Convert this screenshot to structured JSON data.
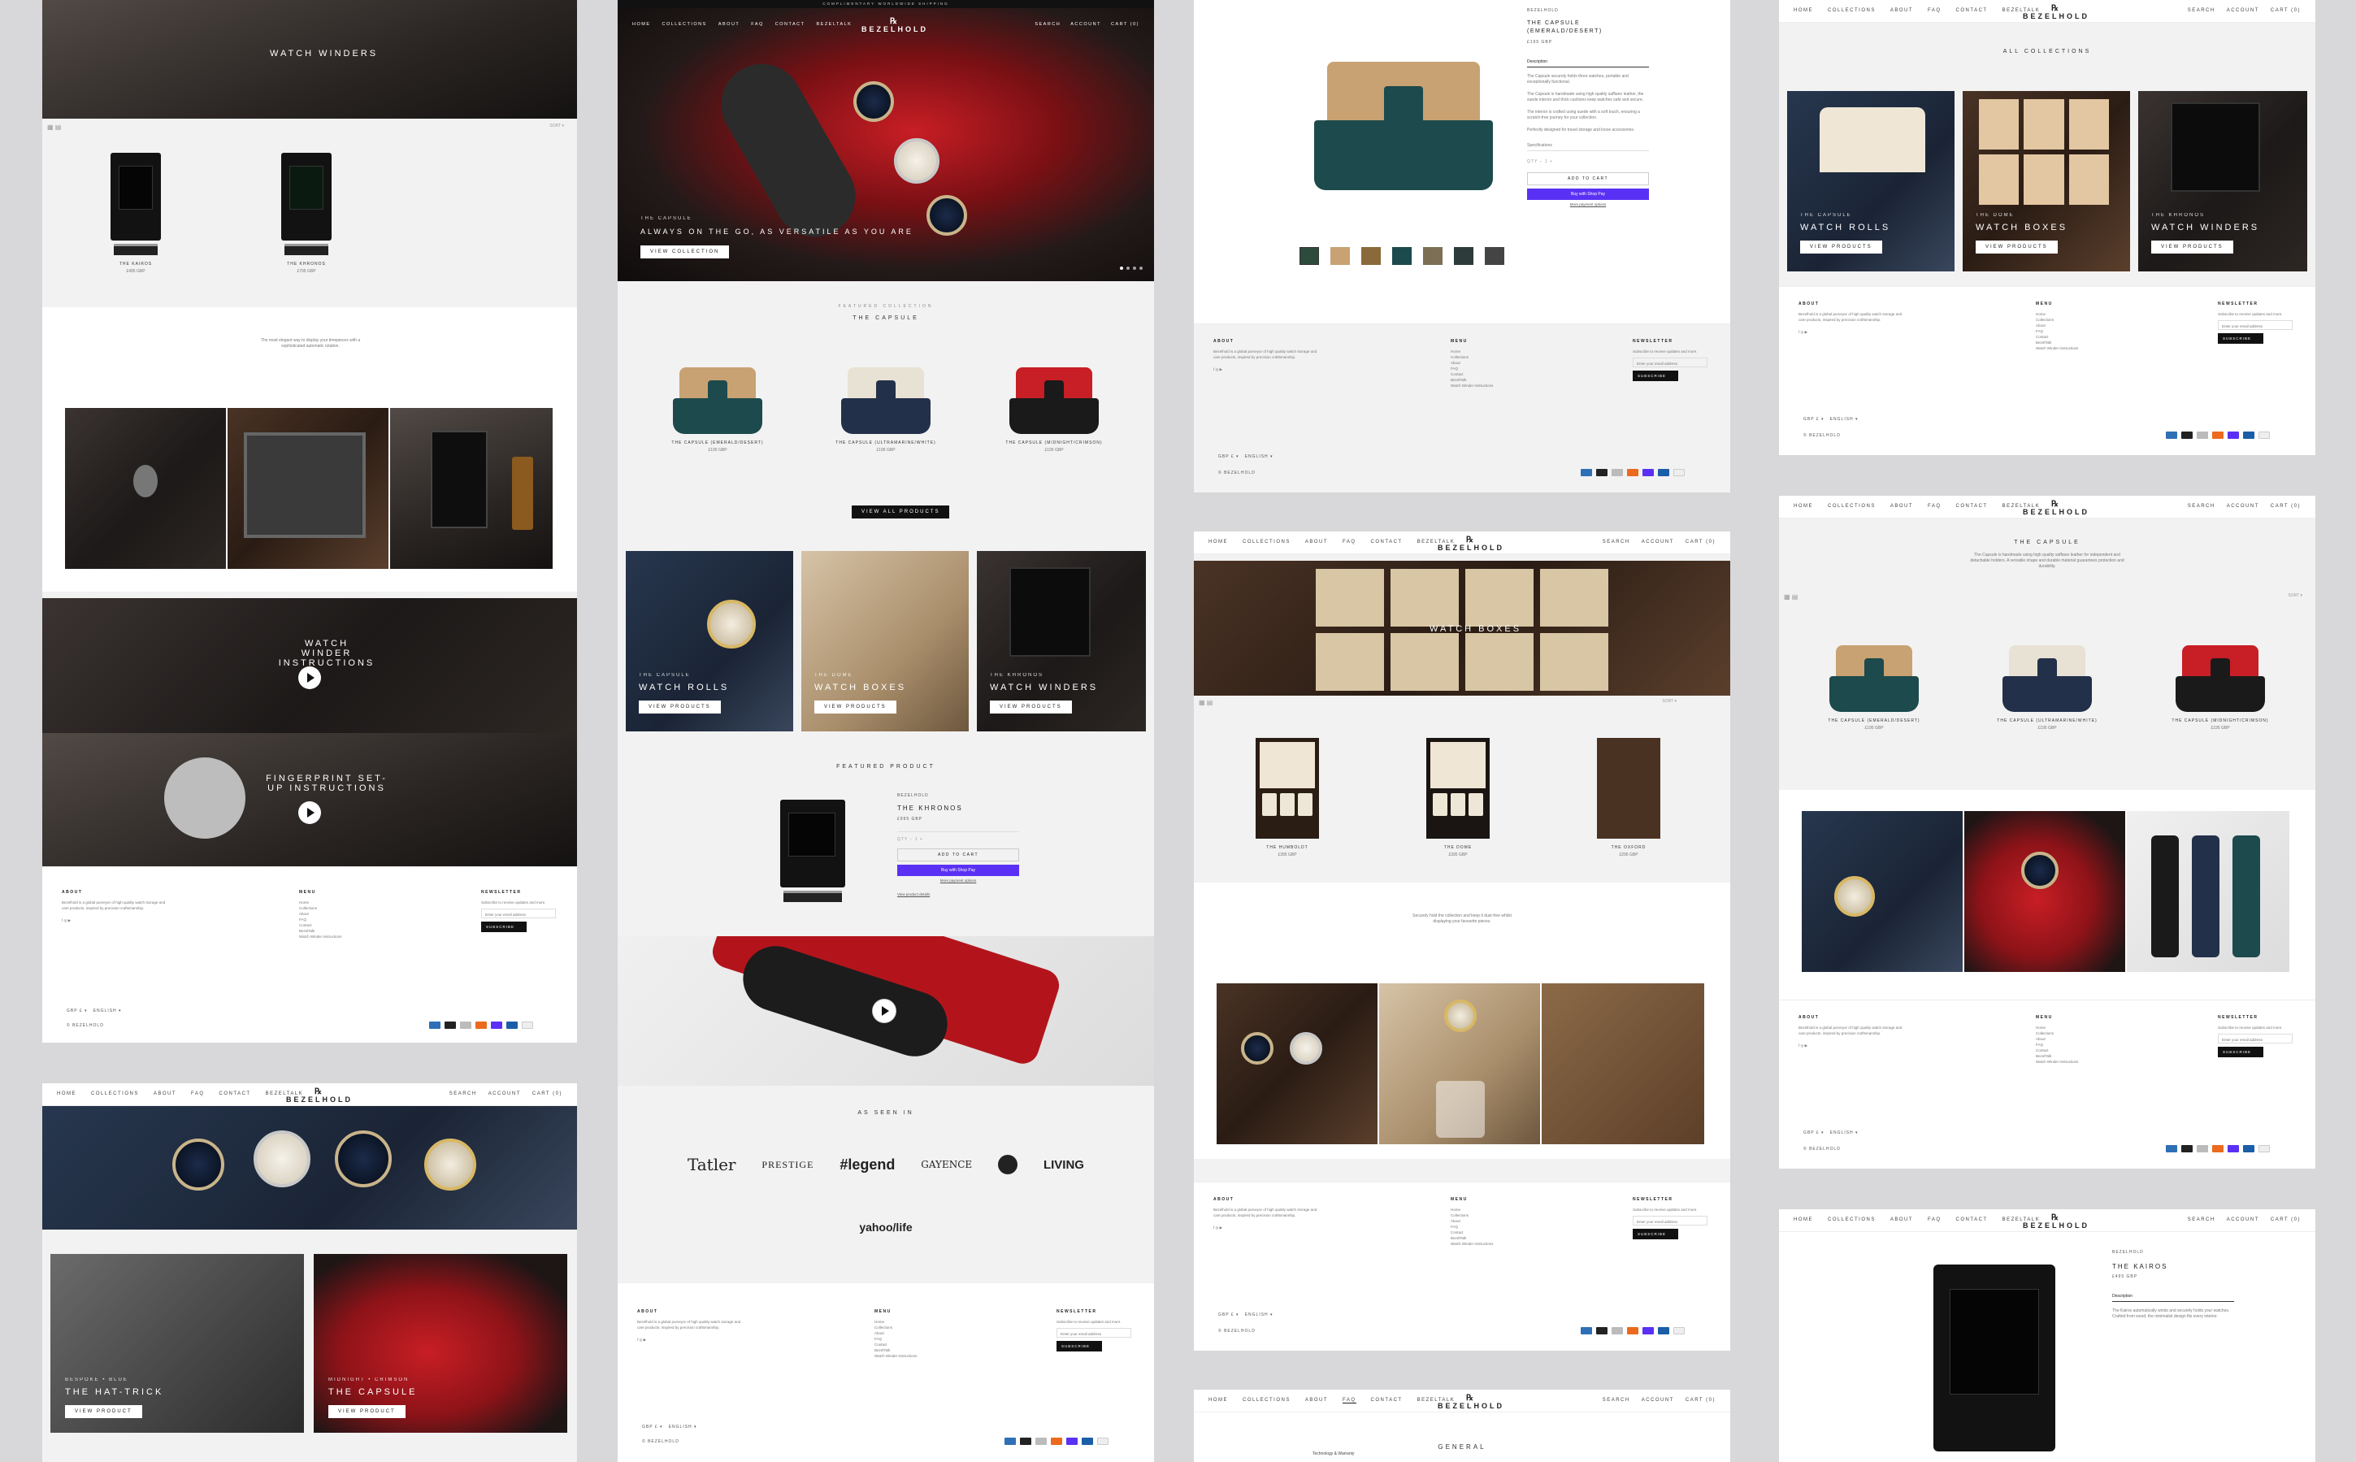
{
  "nav": {
    "links": [
      "HOME",
      "COLLECTIONS",
      "ABOUT",
      "FAQ",
      "CONTACT",
      "BEZELTALK"
    ],
    "right": [
      "SEARCH",
      "ACCOUNT",
      "CART (0)"
    ],
    "brand": "BEZELHOLD",
    "banner": "COMPLIMENTARY WORLDWIDE SHIPPING"
  },
  "col1": {
    "hero_title": "WATCH WINDERS",
    "products": [
      {
        "name": "THE KAIROS",
        "price": "£495 GBP"
      },
      {
        "name": "THE KHRONOS",
        "price": "£795 GBP"
      }
    ],
    "tagline": "The most elegant way to display your timepieces with a sophisticated automatic rotation.",
    "video1": "WATCH WINDER INSTRUCTIONS",
    "video2": "FINGERPRINT SET-UP INSTRUCTIONS",
    "bottom_cards": [
      {
        "sub": "BESPOKE • BLUE",
        "title": "THE HAT-TRICK",
        "btn": "VIEW PRODUCT"
      },
      {
        "sub": "MIDNIGHT • CRIMSON",
        "title": "THE CAPSULE",
        "btn": "VIEW PRODUCT"
      }
    ]
  },
  "col2": {
    "hero_sub": "THE CAPSULE",
    "hero_title": "ALWAYS ON THE GO, AS VERSATILE AS YOU ARE",
    "hero_btn": "VIEW COLLECTION",
    "featured_label": "FEATURED COLLECTION",
    "featured_title": "THE CAPSULE",
    "capsules": [
      {
        "name": "THE CAPSULE (EMERALD/DESERT)",
        "price": "£195 GBP"
      },
      {
        "name": "THE CAPSULE (ULTRAMARINE/WHITE)",
        "price": "£195 GBP"
      },
      {
        "name": "THE CAPSULE (MIDNIGHT/CRIMSON)",
        "price": "£195 GBP"
      }
    ],
    "view_all": "VIEW ALL PRODUCTS",
    "tiles": [
      {
        "sub": "THE CAPSULE",
        "title": "WATCH ROLLS",
        "btn": "VIEW PRODUCTS"
      },
      {
        "sub": "THE DOME",
        "title": "WATCH BOXES",
        "btn": "VIEW PRODUCTS"
      },
      {
        "sub": "THE KHRONOS",
        "title": "WATCH WINDERS",
        "btn": "VIEW PRODUCTS"
      }
    ],
    "featured_product_label": "FEATURED PRODUCT",
    "fp_vendor": "BEZELHOLD",
    "fp_name": "THE KHRONOS",
    "fp_price": "£995 GBP",
    "fp_add": "ADD TO CART",
    "fp_shop": "Buy with Shop Pay",
    "fp_more": "More payment options",
    "fp_full": "View product details",
    "as_seen": "AS SEEN IN",
    "press": [
      "Tatler",
      "PRESTIGE",
      "#legend",
      "GAYENCE",
      "",
      "LIVING",
      "yahoo/life"
    ]
  },
  "col3": {
    "vendor": "BEZELHOLD",
    "title": "THE CAPSULE (EMERALD/DESERT)",
    "price": "£195 GBP",
    "tab": "Description",
    "desc1": "The Capsule securely holds three watches, portable and exceptionally functional.",
    "desc2": "The Capsule is handmade using high quality saffiano leather, the suede interior and thick cushions keep watches safe and secure.",
    "desc3": "The interior is crafted using suede with a soft touch, ensuring a scratch-free journey for your collection.",
    "desc4": "Perfectly designed for travel storage and loose accessories.",
    "spec": "Specifications",
    "qty": "QTY",
    "add": "ADD TO CART",
    "shop": "Buy with Shop Pay",
    "more": "More payment options",
    "coll_title": "WATCH BOXES",
    "boxes": [
      {
        "name": "THE HUMBOLDT",
        "price": "£395 GBP"
      },
      {
        "name": "THE DOME",
        "price": "£395 GBP"
      },
      {
        "name": "THE OXFORD",
        "price": "£295 GBP"
      }
    ],
    "box_tag": "Securely hold the collection and keep it dust-free whilst displaying your favourite pieces.",
    "faq_title": "GENERAL",
    "faq_link": "Technology & Warranty"
  },
  "col4": {
    "all_title": "ALL COLLECTIONS",
    "collections": [
      {
        "sub": "THE CAPSULE",
        "title": "WATCH ROLLS",
        "btn": "VIEW PRODUCTS"
      },
      {
        "sub": "THE DOME",
        "title": "WATCH BOXES",
        "btn": "VIEW PRODUCTS"
      },
      {
        "sub": "THE KHRONOS",
        "title": "WATCH WINDERS",
        "btn": "VIEW PRODUCTS"
      }
    ],
    "capsule_title": "THE CAPSULE",
    "capsule_desc": "The Capsule is handmade using high quality saffiano leather for independent and detachable holders. A versatile shape and durable material guarantees protection and durability.",
    "capsules": [
      {
        "name": "THE CAPSULE (EMERALD/DESERT)",
        "price": "£195 GBP"
      },
      {
        "name": "THE CAPSULE (ULTRAMARINE/WHITE)",
        "price": "£195 GBP"
      },
      {
        "name": "THE CAPSULE (MIDNIGHT/CRIMSON)",
        "price": "£195 GBP"
      }
    ],
    "prod_vendor": "BEZELHOLD",
    "prod_name": "THE KAIROS",
    "prod_price": "£495 GBP",
    "prod_tab": "Description",
    "prod_desc": "The Kairos automatically winds and securely holds your watches. Crafted from wood, the minimalist design fits every interior."
  },
  "footer": {
    "about_h": "ABOUT",
    "about_t": "Bezelhold is a global purveyor of high quality watch storage and care products, inspired by precision craftsmanship.",
    "menu_h": "MENU",
    "menu": [
      "Home",
      "Collections",
      "About",
      "FAQ",
      "Contact",
      "BezelTalk",
      "Watch Winder Instructions"
    ],
    "news_h": "NEWSLETTER",
    "news_t": "Subscribe to receive updates and more.",
    "news_ph": "Enter your email address",
    "subscribe": "SUBSCRIBE",
    "copyright": "© BEZELHOLD",
    "locale": "GBP £",
    "lang": "ENGLISH"
  },
  "colors": {
    "accent": "#5a31f4",
    "dark": "#111111",
    "red": "#c81e25",
    "bg": "#d8d7d9"
  }
}
